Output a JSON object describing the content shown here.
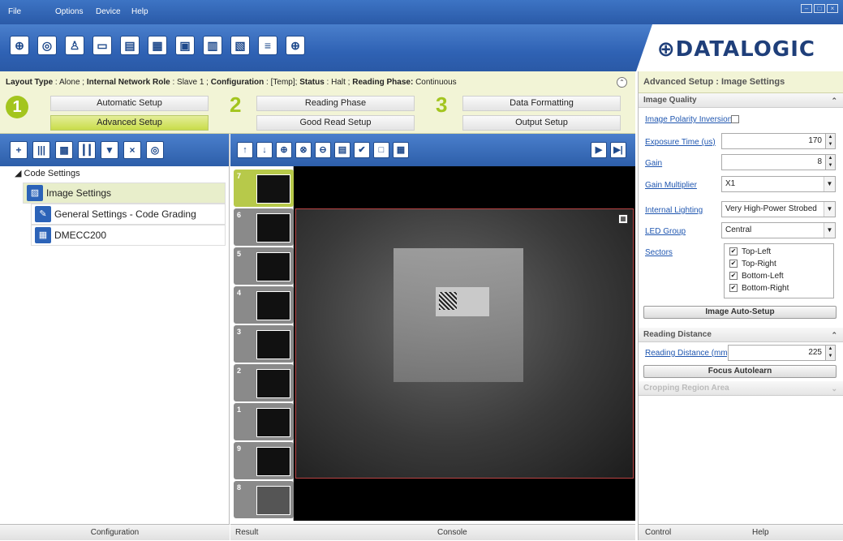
{
  "menu": {
    "file": "File",
    "options": "Options",
    "device": "Device",
    "help": "Help"
  },
  "brand": "⊕DATALOGIC",
  "status": {
    "layout_type_label": "Layout Type",
    "layout_type_value": "Alone",
    "network_role_label": "Internal Network Role",
    "network_role_value": "Slave 1",
    "configuration_label": "Configuration",
    "configuration_value": "[Temp]",
    "status_label": "Status",
    "status_value": "Halt",
    "reading_phase_label": "Reading Phase:",
    "reading_phase_value": "Continuous"
  },
  "steps": {
    "n1": "1",
    "n2": "2",
    "n3": "3",
    "automatic_setup": "Automatic Setup",
    "advanced_setup": "Advanced Setup",
    "reading_phase": "Reading Phase",
    "good_read_setup": "Good Read Setup",
    "data_formatting": "Data Formatting",
    "output_setup": "Output Setup"
  },
  "tree": {
    "root": "Code Settings",
    "image_settings": "Image Settings",
    "general_settings": "General Settings - Code Grading",
    "dmecc": "DMECC200"
  },
  "left_footer": "Configuration",
  "thumbnails": [
    "7",
    "6",
    "5",
    "4",
    "3",
    "2",
    "1",
    "9",
    "8"
  ],
  "bottom_tabs": {
    "result": "Result",
    "console": "Console"
  },
  "right": {
    "title": "Advanced Setup : Image Settings",
    "image_quality": "Image Quality",
    "image_polarity_inversion": "Image Polarity Inversion",
    "exposure_time_label": "Exposure Time (us)",
    "exposure_time_value": "170",
    "gain_label": "Gain",
    "gain_value": "8",
    "gain_multiplier_label": "Gain Multiplier",
    "gain_multiplier_value": "X1",
    "internal_lighting_label": "Internal Lighting",
    "internal_lighting_value": "Very High-Power Strobed",
    "led_group_label": "LED Group",
    "led_group_value": "Central",
    "sectors_label": "Sectors",
    "sectors": [
      "Top-Left",
      "Top-Right",
      "Bottom-Left",
      "Bottom-Right"
    ],
    "image_auto_setup": "Image Auto-Setup",
    "reading_distance_hdr": "Reading Distance",
    "reading_distance_label": "Reading Distance (mm)",
    "reading_distance_value": "225",
    "focus_autolearn": "Focus Autolearn",
    "cropping_region": "Cropping Region Area",
    "tab_control": "Control",
    "tab_help": "Help"
  },
  "colors": {
    "accent": "#a3c51e",
    "toolbar": "#2f62b4",
    "link": "#1f56b0"
  }
}
